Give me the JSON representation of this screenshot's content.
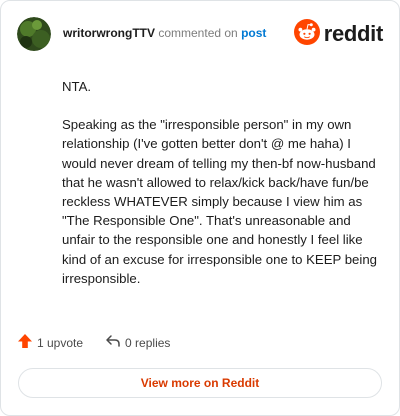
{
  "comment": {
    "username": "writorwrongTTV",
    "action_text": "commented on",
    "post_link": "post",
    "paragraphs": [
      "NTA.",
      "Speaking as the \"irresponsible person\" in my own relationship (I've gotten better don't @ me haha) I would never dream of telling my then-bf now-husband that he wasn't allowed to relax/kick back/have fun/be reckless WHATEVER simply because I view him as \"The Responsible One\". That's unreasonable and unfair to the responsible one and honestly I feel like kind of an excuse for irresponsible one to KEEP being irresponsible."
    ]
  },
  "brand": {
    "name": "reddit",
    "icon": "reddit-logo-icon",
    "color": "#ff4500"
  },
  "footer": {
    "upvote_label": "1 upvote",
    "upvote_icon": "upvote-arrow-icon",
    "reply_label": "0 replies",
    "reply_icon": "reply-arrow-icon"
  },
  "cta": {
    "label": "View more on Reddit",
    "color": "#d93a00"
  }
}
